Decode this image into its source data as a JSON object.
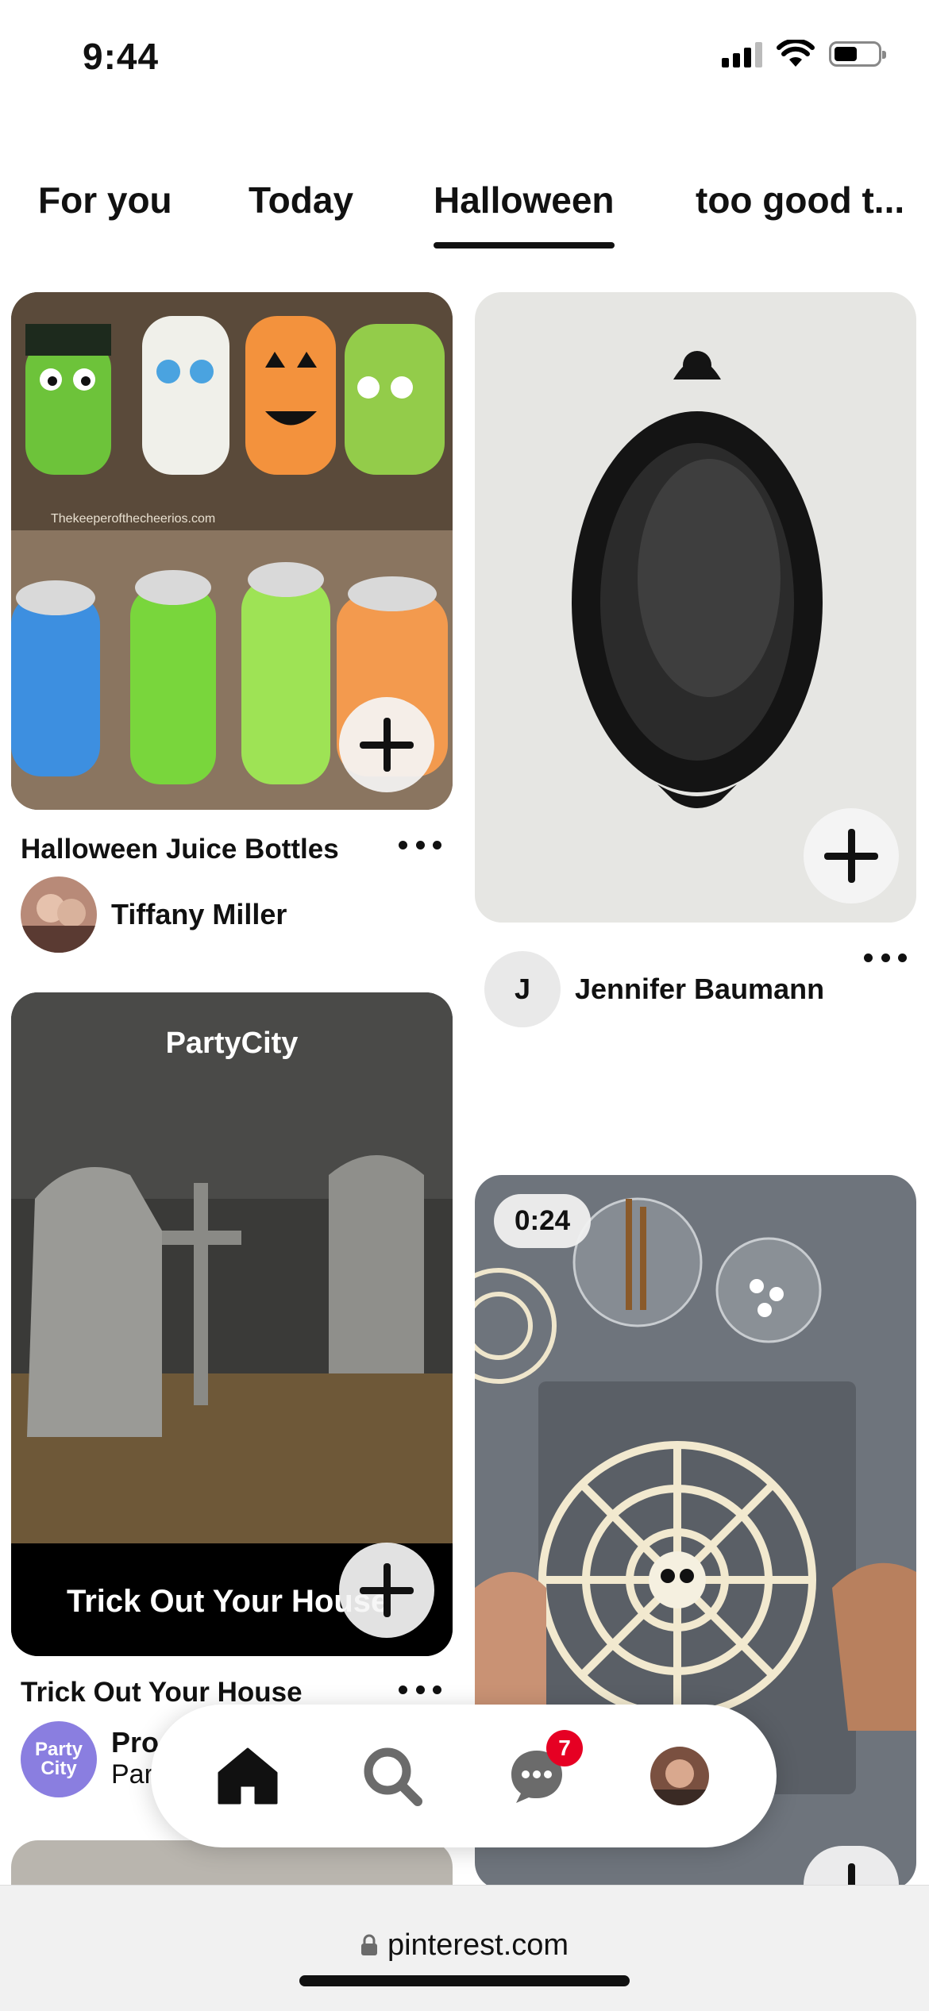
{
  "status_bar": {
    "time": "9:44"
  },
  "tabs": [
    {
      "label": "For you"
    },
    {
      "label": "Today"
    },
    {
      "label": "Halloween",
      "active": true
    },
    {
      "label": "too good t..."
    }
  ],
  "pins": [
    {
      "title": "Halloween Juice Bottles",
      "author": "Tiffany Miller",
      "image_text": "Thekeeperofthecheerios.com"
    },
    {
      "title": "",
      "author": "Jennifer Baumann",
      "author_initial": "J"
    },
    {
      "title": "Trick Out Your House",
      "author": "Pro",
      "author_sub": "Par",
      "image_header": "PartyCity",
      "image_caption": "Trick Out Your House",
      "avatar_text": "Party City"
    },
    {
      "duration": "0:24"
    }
  ],
  "nav": {
    "messages_badge": "7"
  },
  "browser": {
    "url": "pinterest.com"
  },
  "colors": {
    "badge": "#e60023",
    "active_tab": "#111111",
    "partycity_avatar": "#8a7ee0"
  }
}
